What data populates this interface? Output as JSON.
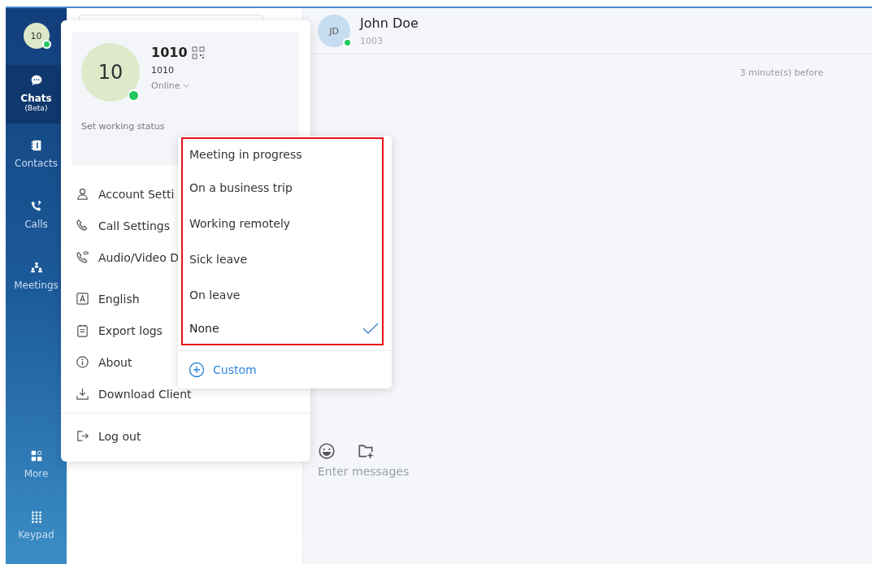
{
  "sidebar": {
    "avatar": {
      "initials": "10",
      "online": true
    },
    "items": [
      {
        "label": "Chats",
        "sublabel": "(Beta)",
        "selected": true
      },
      {
        "label": "Contacts",
        "selected": false
      },
      {
        "label": "Calls",
        "selected": false
      },
      {
        "label": "Meetings",
        "selected": false
      }
    ],
    "bottom_items": [
      {
        "label": "More"
      },
      {
        "label": "Keypad"
      }
    ]
  },
  "profile_menu": {
    "card": {
      "initials": "10",
      "online": true,
      "name": "1010",
      "number": "1010",
      "presence": "Online",
      "working_status_label": "Set working status"
    },
    "items": [
      {
        "label": "Account Setti"
      },
      {
        "label": "Call Settings"
      },
      {
        "label": "Audio/Video D"
      },
      {
        "label": "English"
      },
      {
        "label": "Export logs"
      },
      {
        "label": "About"
      },
      {
        "label": "Download Client"
      }
    ],
    "logout": "Log out"
  },
  "status_menu": {
    "options": [
      {
        "label": "Meeting in progress",
        "selected": false
      },
      {
        "label": "On a business trip",
        "selected": false
      },
      {
        "label": "Working remotely",
        "selected": false
      },
      {
        "label": "Sick leave",
        "selected": false
      },
      {
        "label": "On leave",
        "selected": false
      },
      {
        "label": "None",
        "selected": true
      }
    ],
    "custom": "Custom"
  },
  "chat": {
    "contact": {
      "initials": "JD",
      "name": "John Doe",
      "extension": "1003",
      "online": true
    },
    "timestamp": "3 minute(s) before",
    "composer": {
      "placeholder": "Enter messages"
    }
  }
}
